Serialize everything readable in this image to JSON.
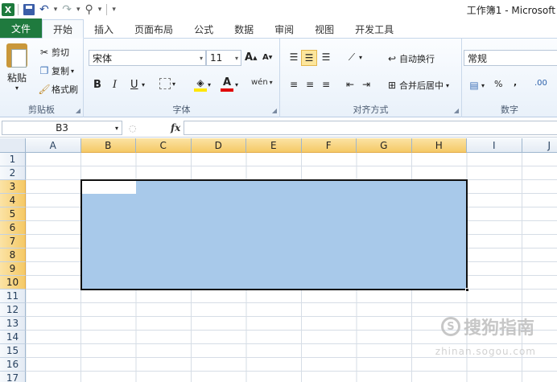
{
  "window": {
    "title": "工作簿1 - Microsoft"
  },
  "qat": {
    "logo_letter": "X",
    "undo_glyph": "↶",
    "redo_glyph": "↷",
    "caret": "▾",
    "custom_glyph": "⚲"
  },
  "tabs": [
    {
      "label": "文件"
    },
    {
      "label": "开始"
    },
    {
      "label": "插入"
    },
    {
      "label": "页面布局"
    },
    {
      "label": "公式"
    },
    {
      "label": "数据"
    },
    {
      "label": "审阅"
    },
    {
      "label": "视图"
    },
    {
      "label": "开发工具"
    }
  ],
  "ribbon": {
    "clipboard": {
      "label": "剪贴板",
      "paste": "粘贴",
      "cut": "剪切",
      "copy": "复制",
      "format_painter": "格式刷"
    },
    "font": {
      "label": "字体",
      "font_name": "宋体",
      "font_size": "11",
      "bold": "B",
      "italic": "I",
      "underline": "U",
      "grow": "A",
      "shrink": "A",
      "phonetic": "wén",
      "font_color_glyph": "A"
    },
    "alignment": {
      "label": "对齐方式",
      "wrap_text": "自动换行",
      "merge_center": "合并后居中"
    },
    "number": {
      "label": "数字",
      "format": "常规",
      "percent": "%",
      "comma": ",",
      "decimal": ".00"
    }
  },
  "formula_bar": {
    "name_box": "B3",
    "fx": "fx",
    "value": ""
  },
  "grid": {
    "columns": [
      "A",
      "B",
      "C",
      "D",
      "E",
      "F",
      "G",
      "H",
      "I",
      "J"
    ],
    "rows": [
      "1",
      "2",
      "3",
      "4",
      "5",
      "6",
      "7",
      "8",
      "9",
      "10",
      "11",
      "12",
      "13",
      "14",
      "15",
      "16",
      "17"
    ],
    "selected_columns": [
      "B",
      "C",
      "D",
      "E",
      "F",
      "G",
      "H"
    ],
    "selected_rows": [
      "3",
      "4",
      "5",
      "6",
      "7",
      "8",
      "9",
      "10"
    ],
    "active_cell": "B3",
    "selection_color": "#a8c9ea"
  },
  "watermark": {
    "text": "搜狗指南",
    "url": "zhinan.sogou.com",
    "symbol": "S"
  }
}
